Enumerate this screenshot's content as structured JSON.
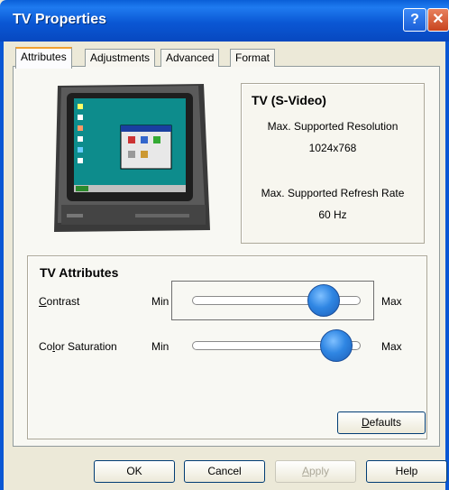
{
  "window": {
    "title": "TV Properties",
    "help_glyph": "?",
    "close_glyph": "✕"
  },
  "tabs": [
    {
      "label": "Attributes",
      "active": true
    },
    {
      "label": "Adjustments",
      "active": false
    },
    {
      "label": "Advanced",
      "active": false
    },
    {
      "label": "Format",
      "active": false
    }
  ],
  "info": {
    "title": "TV (S-Video)",
    "resolution_label": "Max. Supported Resolution",
    "resolution_value": "1024x768",
    "refresh_label": "Max. Supported Refresh Rate",
    "refresh_value": "60 Hz"
  },
  "attributes": {
    "title": "TV Attributes",
    "sliders": [
      {
        "label_first": "C",
        "label_rest": "ontrast",
        "min_label": "Min",
        "max_label": "Max",
        "value_fraction": 0.85
      },
      {
        "label_first": "Co",
        "label_u": "l",
        "label_rest": "or Saturation",
        "min_label": "Min",
        "max_label": "Max",
        "value_fraction": 0.94
      }
    ],
    "defaults_label_u": "D",
    "defaults_label_rest": "efaults"
  },
  "buttons": {
    "ok": "OK",
    "cancel": "Cancel",
    "apply_u": "A",
    "apply_rest": "pply",
    "help": "Help"
  },
  "colors": {
    "titlebar": "#0a57d4",
    "accent_tab": "#f0a030",
    "slider_thumb": "#2f86e3"
  }
}
